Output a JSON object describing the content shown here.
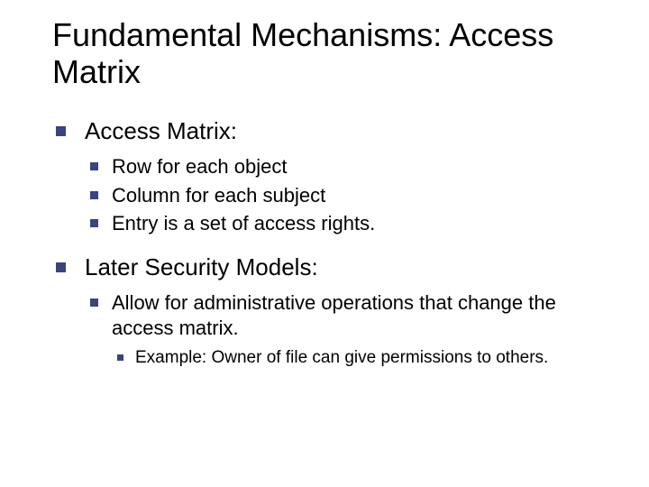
{
  "title": "Fundamental Mechanisms: Access Matrix",
  "points": [
    {
      "text": "Access Matrix:",
      "sub": [
        {
          "text": "Row for each object"
        },
        {
          "text": "Column for each subject"
        },
        {
          "text": "Entry is a set of access rights."
        }
      ]
    },
    {
      "text": "Later Security Models:",
      "sub": [
        {
          "text": "Allow for administrative operations that change the access matrix.",
          "sub": [
            {
              "text": "Example: Owner of file can give permissions to others."
            }
          ]
        }
      ]
    }
  ]
}
